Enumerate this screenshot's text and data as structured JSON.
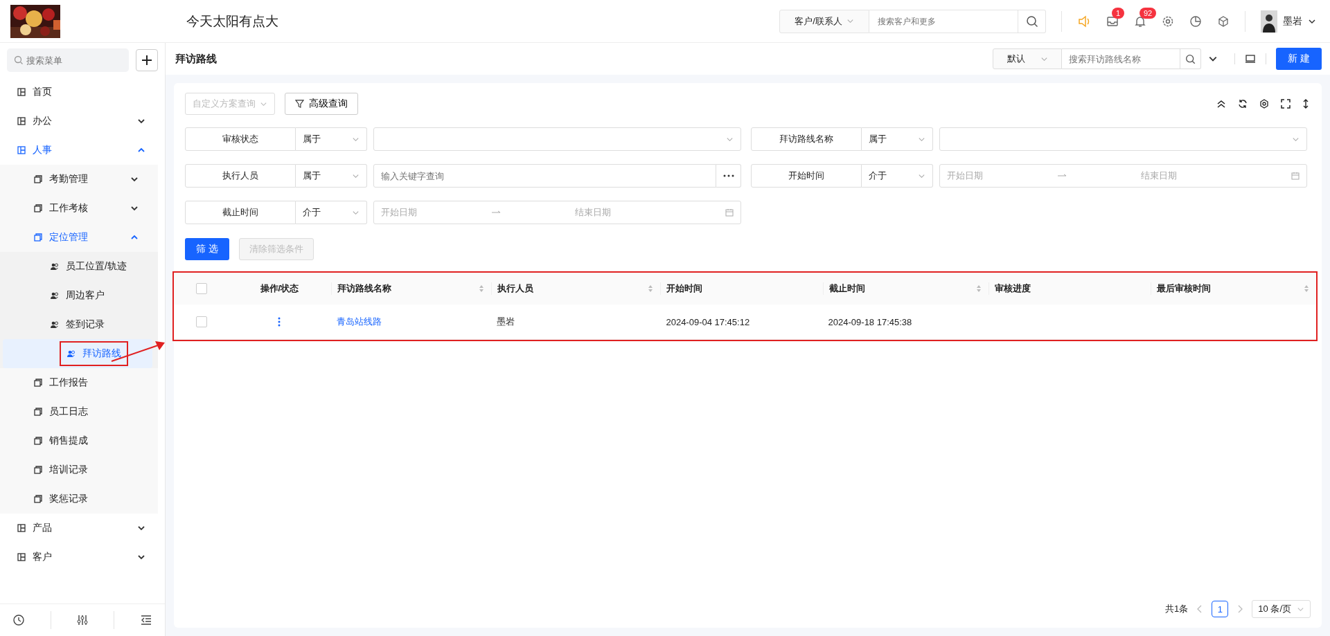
{
  "header": {
    "app_title": "今天太阳有点大",
    "search_scope": "客户/联系人",
    "search_placeholder": "搜索客户和更多",
    "mail_badge": "1",
    "notice_badge": "92",
    "user_name": "墨岩"
  },
  "sidebar": {
    "search_placeholder": "搜索菜单",
    "items": [
      {
        "label": "首页",
        "kind": "link",
        "selected": false
      },
      {
        "label": "办公",
        "kind": "group",
        "expanded": false
      },
      {
        "label": "人事",
        "kind": "group",
        "expanded": true,
        "children": [
          {
            "label": "考勤管理",
            "kind": "group",
            "expanded": false
          },
          {
            "label": "工作考核",
            "kind": "group",
            "expanded": false
          },
          {
            "label": "定位管理",
            "kind": "group",
            "expanded": true,
            "children": [
              {
                "label": "员工位置/轨迹",
                "kind": "link",
                "selected": false
              },
              {
                "label": "周边客户",
                "kind": "link",
                "selected": false
              },
              {
                "label": "签到记录",
                "kind": "link",
                "selected": false
              },
              {
                "label": "拜访路线",
                "kind": "link",
                "selected": true
              }
            ]
          },
          {
            "label": "工作报告",
            "kind": "link",
            "selected": false
          },
          {
            "label": "员工日志",
            "kind": "link",
            "selected": false
          },
          {
            "label": "销售提成",
            "kind": "link",
            "selected": false
          },
          {
            "label": "培训记录",
            "kind": "link",
            "selected": false
          },
          {
            "label": "奖惩记录",
            "kind": "link",
            "selected": false
          }
        ]
      },
      {
        "label": "产品",
        "kind": "group",
        "expanded": false
      },
      {
        "label": "客户",
        "kind": "group",
        "expanded": false
      }
    ]
  },
  "page": {
    "title": "拜访路线",
    "scheme": "默认",
    "search_placeholder": "搜索拜访路线名称",
    "new_button": "新 建"
  },
  "query": {
    "scheme_placeholder": "自定义方案查询",
    "advanced_button": "高级查询",
    "filters": [
      {
        "label": "审核状态",
        "operator": "属于",
        "kind": "select"
      },
      {
        "label": "拜访路线名称",
        "operator": "属于",
        "kind": "select"
      },
      {
        "label": "执行人员",
        "operator": "属于",
        "kind": "keyword",
        "placeholder": "输入关键字查询"
      },
      {
        "label": "开始时间",
        "operator": "介于",
        "kind": "daterange",
        "start_placeholder": "开始日期",
        "end_placeholder": "结束日期"
      },
      {
        "label": "截止时间",
        "operator": "介于",
        "kind": "daterange",
        "start_placeholder": "开始日期",
        "end_placeholder": "结束日期"
      }
    ],
    "filter_button": "筛 选",
    "clear_button": {
      "label": "清除筛选条件",
      "disabled": true
    }
  },
  "table": {
    "header_checked": false,
    "columns": [
      {
        "label": "操作/状态",
        "sortable": false
      },
      {
        "label": "拜访路线名称",
        "sortable": true
      },
      {
        "label": "执行人员",
        "sortable": true
      },
      {
        "label": "开始时间",
        "sortable": false
      },
      {
        "label": "截止时间",
        "sortable": true
      },
      {
        "label": "审核进度",
        "sortable": false
      },
      {
        "label": "最后审核时间",
        "sortable": true
      }
    ],
    "rows": [
      {
        "checked": false,
        "name": "青岛站线路",
        "executor": "墨岩",
        "start": "2024-09-04 17:45:12",
        "end": "2024-09-18 17:45:38"
      }
    ]
  },
  "pagination": {
    "total": "共1条",
    "pages": [
      {
        "label": "1",
        "selected": true
      }
    ],
    "page_size": "10 条/页"
  }
}
